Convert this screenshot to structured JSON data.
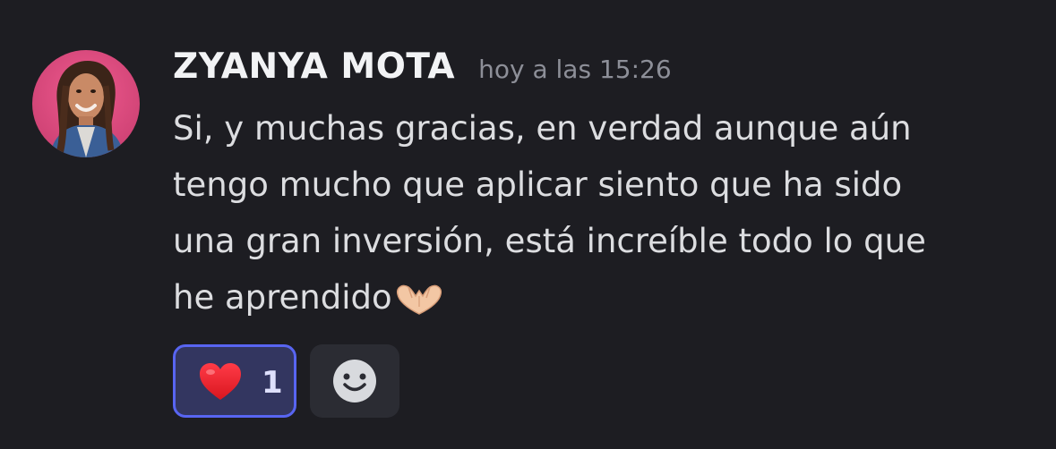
{
  "message": {
    "author": "ZYANYA MOTA",
    "timestamp": "hoy a las 15:26",
    "avatar_icon": "user-avatar-photo",
    "lines": [
      "Si, y muchas gracias, en verdad aunque aún",
      "tengo mucho que aplicar siento que ha sido",
      "una gran inversión, está increíble todo lo que",
      "he aprendido"
    ],
    "trailing_emoji": "heart-hands-emoji"
  },
  "reactions": [
    {
      "emoji": "red-heart-emoji",
      "count": "1",
      "active": true
    }
  ],
  "add_reaction": {
    "icon": "smiley-face-icon"
  },
  "colors": {
    "background": "#1d1d22",
    "accent": "#5865f2",
    "reaction_active_bg": "#333660",
    "username": "#f2f3f5",
    "timestamp": "#8d8f98",
    "text": "#dcdde0"
  }
}
